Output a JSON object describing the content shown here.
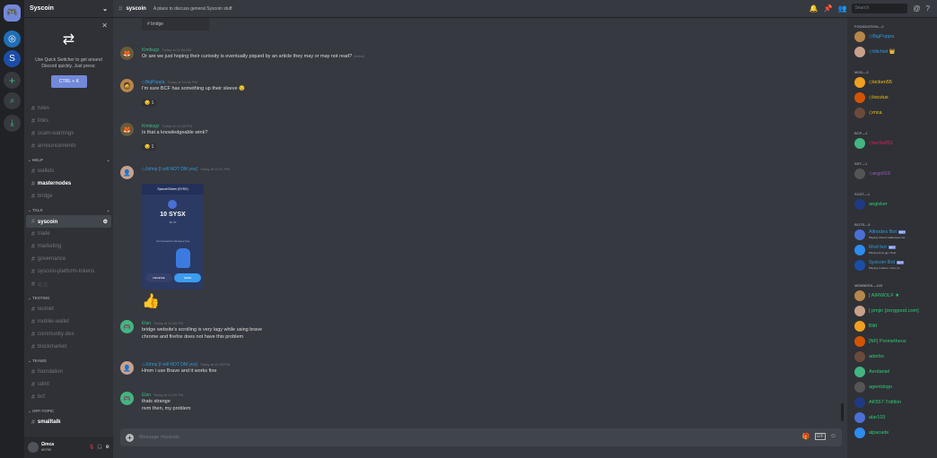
{
  "server": {
    "name": "Syscoin"
  },
  "quick_switcher": {
    "text": "Use Quick Switcher to get around Discord quickly. Just press:",
    "shortcut": "CTRL + K"
  },
  "channels": {
    "top": [
      "rules",
      "links",
      "scam-warnings",
      "announcements"
    ],
    "help_label": "HELP",
    "help": [
      "wallets",
      "masternodes",
      "bridge"
    ],
    "talk_label": "TALK",
    "talk": [
      "syscoin",
      "trade",
      "marketing",
      "governance",
      "syscoin-platform-tokens",
      "中文"
    ],
    "testing_label": "TESTING",
    "testing": [
      "testnet",
      "mobile-wallet",
      "community-dex",
      "blockmarket"
    ],
    "teams_label": "TEAMS",
    "teams": [
      "foundation",
      "sdmt",
      "bcf"
    ],
    "offtopic_label": "OFF-TOPIC",
    "offtopic": [
      "smalltalk"
    ]
  },
  "user": {
    "name": "Ωmca",
    "tag": "#5790"
  },
  "header": {
    "channel": "syscoin",
    "topic": "A place to discuss general Syscoin stuff",
    "search_placeholder": "Search"
  },
  "messages": [
    {
      "author": "Kimbugz",
      "time": "Today at 11:54 AM",
      "text": "Or are we just hoping their curiosity is eventually piqued by an article they may or may not read?",
      "edited": "(edited)"
    },
    {
      "author": "◇BigPoppa",
      "time": "Today at 12:06 PM",
      "text": "I'm sure BCF has something up their sleeve 😏",
      "reaction": "😏 1"
    },
    {
      "author": "Kimbugz",
      "time": "Today at 12:08 PM",
      "text": "Is that a knowledgeable wink?",
      "reaction": "😏 1"
    },
    {
      "author": "◇Johnp [I will NOT DM you]",
      "time": "Today at 12:11 PM"
    },
    {
      "author": "Elan",
      "time": "Today at 12:26 PM",
      "lines": [
        "bridge website's scrolling is very lagy while using brave",
        "chrome and firefox does not have this problem"
      ]
    },
    {
      "author": "◇Johnp [I will NOT DM you]",
      "time": "Today at 12:28 PM",
      "text": "Hmm i use Brave and it works fine"
    },
    {
      "author": "Elan",
      "time": "Today at 12:29 PM",
      "lines": [
        "thats strange",
        "nvm then, my problem"
      ]
    }
  ],
  "phone": {
    "title": "SyscoinToken (SYSX)",
    "amount": "10 SYSX",
    "sub": "$0.00",
    "note": "Your transactions will appear here",
    "receive": "RECEIVE",
    "send": "SEND"
  },
  "thumbs": "👍",
  "partial_attachment": "bridge",
  "input_placeholder": "Message #syscoin",
  "member_groups": [
    {
      "label": "FOUNDATION—2",
      "members": [
        {
          "name": "◇BigPoppa",
          "color": "#3498db"
        },
        {
          "name": "◇Michiel 👑",
          "color": "#3498db"
        }
      ]
    },
    {
      "label": "MOD—3",
      "members": [
        {
          "name": "◇kicken55",
          "color": "#f1c40f"
        },
        {
          "name": "◇locutus",
          "color": "#f1c40f"
        },
        {
          "name": "◇mca",
          "color": "#f1c40f"
        }
      ]
    },
    {
      "label": "BCF—1",
      "members": [
        {
          "name": "◇techo051",
          "color": "#e91e63"
        }
      ]
    },
    {
      "label": "SDT—1",
      "members": [
        {
          "name": "◇argoll19",
          "color": "#9b59b6"
        }
      ]
    },
    {
      "label": "SCDT—1",
      "members": [
        {
          "name": "aegisker",
          "color": "#2ecc71"
        }
      ]
    },
    {
      "label": "BOTS—3",
      "members": [
        {
          "name": "Allnodes Bot",
          "color": "#3498db",
          "bot": "BOT",
          "activity": "Playing !sheeh !addresses !sa..."
        },
        {
          "name": "Mod bot",
          "color": "#3498db",
          "bot": "BOT",
          "activity": "Playing dyno.gg | !help"
        },
        {
          "name": "Syscoin Bot",
          "color": "#3498db",
          "bot": "BOT",
          "activity": "Playing !market | !new | ip"
        }
      ]
    },
    {
      "label": "MEMBERS—105",
      "members": [
        {
          "name": "[ AIRWOLF ★",
          "color": "#2ecc71"
        },
        {
          "name": "[ pmjin [zerggood.com]",
          "color": "#2ecc71"
        },
        {
          "name": "Blitt",
          "color": "#2ecc71"
        },
        {
          "name": "[NF] Prometheus",
          "color": "#2ecc71"
        },
        {
          "name": "aderbs",
          "color": "#2ecc71"
        },
        {
          "name": "Aerdaniel",
          "color": "#2ecc71"
        },
        {
          "name": "agentdogo",
          "color": "#2ecc71"
        },
        {
          "name": "AK557-Trdllion",
          "color": "#2ecc71"
        },
        {
          "name": "alar103",
          "color": "#2ecc71"
        },
        {
          "name": "alpacade",
          "color": "#2ecc71"
        }
      ]
    }
  ]
}
